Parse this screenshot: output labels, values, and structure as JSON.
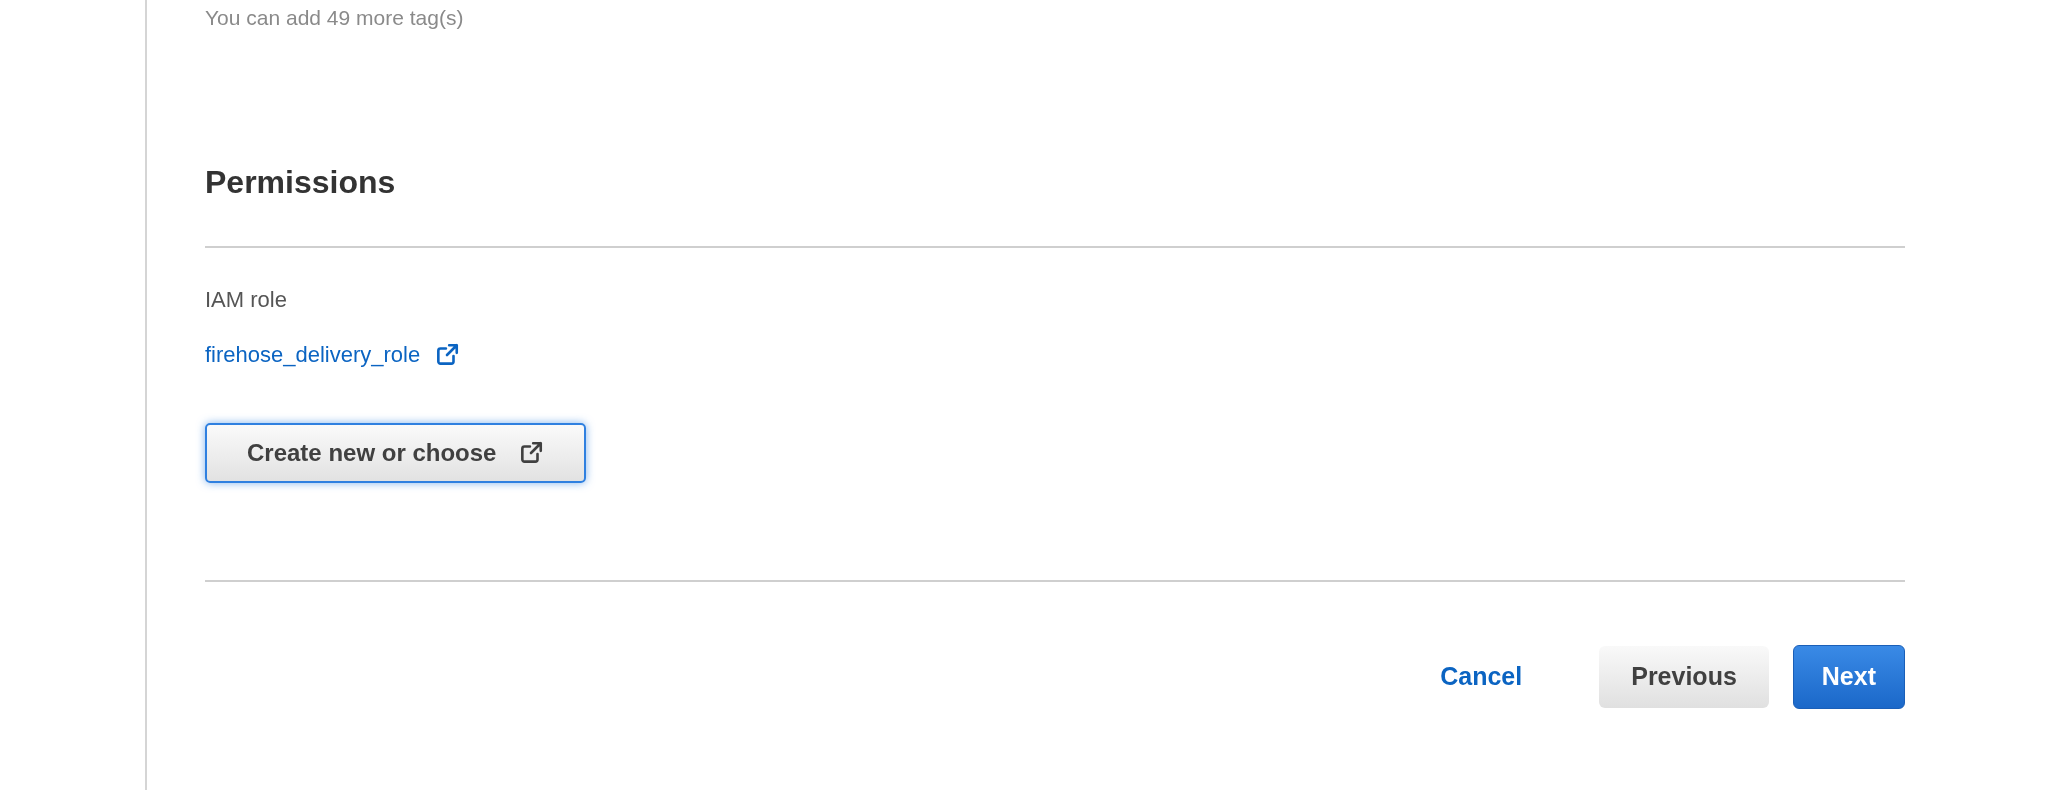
{
  "tags_hint": "You can add 49 more tag(s)",
  "permissions": {
    "title": "Permissions",
    "iam_role_label": "IAM role",
    "iam_role_link": "firehose_delivery_role",
    "create_button": {
      "label": "Create new or choose",
      "focused": true
    }
  },
  "footer_buttons": [
    {
      "label": "Cancel",
      "kind": "link"
    },
    {
      "label": "Previous",
      "kind": "secondary"
    },
    {
      "label": "Next",
      "kind": "primary"
    }
  ]
}
